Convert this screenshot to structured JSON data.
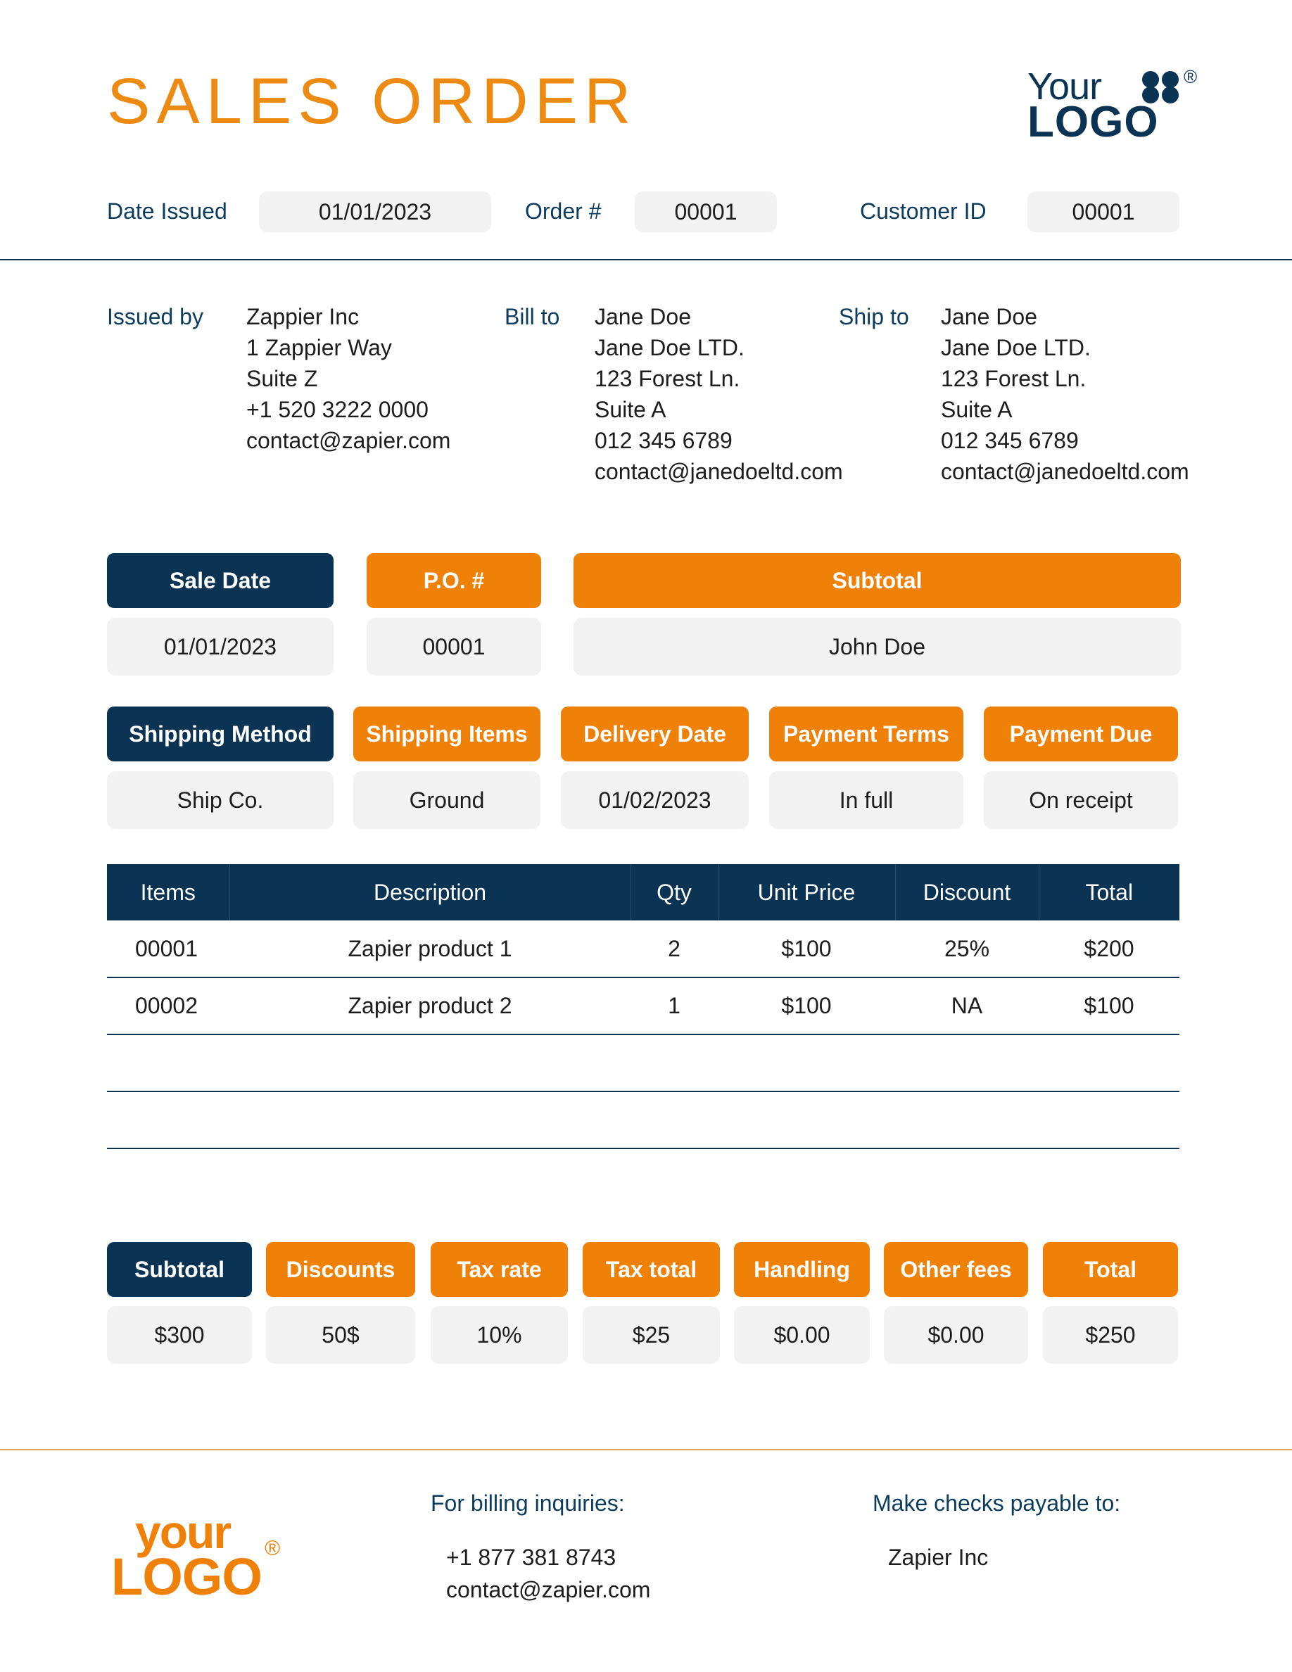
{
  "header": {
    "title": "SALES ORDER",
    "logo_text_top": "Your",
    "logo_text_bottom": "LOGO",
    "logo_reg": "®"
  },
  "meta": {
    "date_issued_label": "Date Issued",
    "date_issued_value": "01/01/2023",
    "order_label": "Order #",
    "order_value": "00001",
    "customer_id_label": "Customer ID",
    "customer_id_value": "00001"
  },
  "parties": {
    "issued_by_label": "Issued by",
    "issued_by": [
      "Zappier Inc",
      "1 Zappier Way",
      "Suite Z",
      "+1 520 3222 0000",
      "contact@zapier.com"
    ],
    "bill_to_label": "Bill to",
    "bill_to": [
      "Jane Doe",
      "Jane Doe LTD.",
      "123 Forest Ln.",
      "Suite A",
      "012 345 6789",
      "contact@janedoeltd.com"
    ],
    "ship_to_label": "Ship to",
    "ship_to": [
      "Jane Doe",
      "Jane Doe LTD.",
      "123 Forest Ln.",
      "Suite A",
      "012 345 6789",
      "contact@janedoeltd.com"
    ]
  },
  "sale_info": {
    "sale_date_label": "Sale Date",
    "sale_date_value": "01/01/2023",
    "po_label": "P.O. #",
    "po_value": "00001",
    "subtotal_label": "Subtotal",
    "subtotal_value": "John Doe"
  },
  "shipping": {
    "method_label": "Shipping Method",
    "method_value": "Ship Co.",
    "items_label": "Shipping Items",
    "items_value": "Ground",
    "delivery_label": "Delivery Date",
    "delivery_value": "01/02/2023",
    "terms_label": "Payment Terms",
    "terms_value": "In full",
    "due_label": "Payment Due",
    "due_value": "On receipt"
  },
  "table": {
    "columns": [
      "Items",
      "Description",
      "Qty",
      "Unit Price",
      "Discount",
      "Total"
    ],
    "rows": [
      [
        "00001",
        "Zapier product 1",
        "2",
        "$100",
        "25%",
        "$200"
      ],
      [
        "00002",
        "Zapier product 2",
        "1",
        "$100",
        "NA",
        "$100"
      ],
      [
        "",
        "",
        "",
        "",
        "",
        ""
      ],
      [
        "",
        "",
        "",
        "",
        "",
        ""
      ]
    ]
  },
  "totals": {
    "subtotal_label": "Subtotal",
    "subtotal_value": "$300",
    "discounts_label": "Discounts",
    "discounts_value": "50$",
    "tax_rate_label": "Tax rate",
    "tax_rate_value": "10%",
    "tax_total_label": "Tax total",
    "tax_total_value": "$25",
    "handling_label": "Handling",
    "handling_value": "$0.00",
    "other_fees_label": "Other fees",
    "other_fees_value": "$0.00",
    "total_label": "Total",
    "total_value": "$250"
  },
  "footer": {
    "logo_text_top": "your",
    "logo_text_bottom": "LOGO",
    "logo_reg": "®",
    "billing_label": "For billing inquiries:",
    "billing_phone": "+1 877 381 8743",
    "billing_email": "contact@zapier.com",
    "checks_label": "Make checks payable to:",
    "checks_value": "Zapier Inc"
  },
  "colors": {
    "navy": "#0b3354",
    "orange": "#ef8008",
    "title_orange": "#ec8a12",
    "field_gray": "#f2f2f2"
  }
}
